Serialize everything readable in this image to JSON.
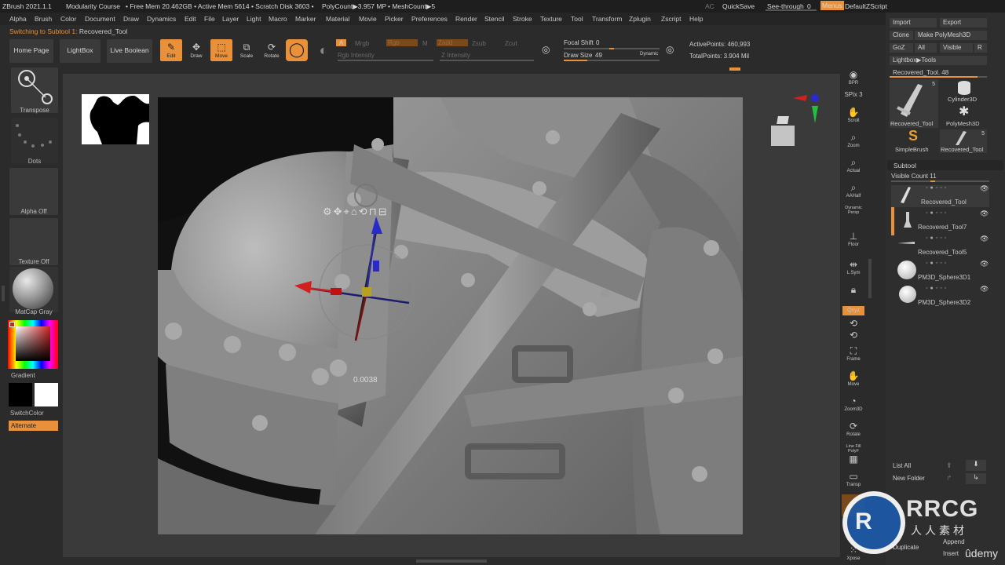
{
  "titlebar": {
    "app": "ZBrush 2021.1.1",
    "doc": "Modularity Course",
    "mem": "• Free Mem 20.462GB • Active Mem 5614 • Scratch Disk 3603 •",
    "poly": "PolyCount▶3.957 MP",
    "mesh": "• MeshCount▶5",
    "ac": "AC",
    "quicksave": "QuickSave",
    "seethrough": "See-through",
    "seethrough_val": "0",
    "menus": "Menus",
    "script": "DefaultZScript"
  },
  "menubar": [
    "Alpha",
    "Brush",
    "Color",
    "Document",
    "Draw",
    "Dynamics",
    "Edit",
    "File",
    "Layer",
    "Light",
    "Macro",
    "Marker",
    "Material",
    "Movie",
    "Picker",
    "Preferences",
    "Render",
    "Stencil",
    "Stroke",
    "Texture",
    "Tool",
    "Transform",
    "Zplugin",
    "Zscript",
    "Help"
  ],
  "notice": {
    "prefix": "Switching to Subtool 1:",
    "name": "Recovered_Tool"
  },
  "toolbar": {
    "home": "Home Page",
    "lightbox": "LightBox",
    "liveboolean": "Live Boolean",
    "edit": "Edit",
    "draw": "Draw",
    "move": "Move",
    "scale": "Scale",
    "rotate": "Rotate",
    "a": "A",
    "mrgb": "Mrgb",
    "rgb": "Rgb",
    "m": "M",
    "zadd": "Zadd",
    "zsub": "Zsub",
    "zcut": "Zcut",
    "rgb_intensity": "Rgb Intensity",
    "z_intensity": "Z Intensity",
    "focal_shift_label": "Focal Shift",
    "focal_shift_value": "0",
    "draw_size_label": "Draw Size",
    "draw_size_value": "49",
    "dynamic": "Dynamic",
    "active_points": "ActivePoints: 460,993",
    "total_points": "TotalPoints: 3.904 Mil"
  },
  "leftshelf": {
    "transpose": "Transpose",
    "dots": "Dots",
    "alpha": "Alpha Off",
    "texture": "Texture Off",
    "matcap": "MatCap Gray",
    "gradient": "Gradient",
    "switchcolor": "SwitchColor",
    "alternate": "Alternate"
  },
  "viewport": {
    "readout": "0.0038"
  },
  "rightshelf": [
    "BPR",
    "SPix 3",
    "Scroll",
    "Zoom",
    "Actual",
    "AAHalf",
    "Dynamic Persp",
    "Floor",
    "L.Sym",
    "Lock",
    "Qxyz",
    "Frame",
    "Move",
    "Zoom3D",
    "Rotate",
    "Line Fill PolyF",
    "Transp",
    "Xpose"
  ],
  "rightpanel": {
    "import": "Import",
    "export": "Export",
    "clone": "Clone",
    "make_polymesh": "Make PolyMesh3D",
    "goz": "GoZ",
    "all": "All",
    "visible": "Visible",
    "r": "R",
    "lightbox_tools": "Lightbox▶Tools",
    "tool_name": "Recovered_Tool. 48",
    "thumbs": [
      "Recovered_Tool",
      "Cylinder3D",
      "PolyMesh3D",
      "SimpleBrush",
      "Recovered_Tool"
    ],
    "thumb_counts": [
      "5",
      "5"
    ],
    "subtool_header": "Subtool",
    "visible_count": "Visible Count 11",
    "subtools": [
      "Recovered_Tool",
      "Recovered_Tool7",
      "Recovered_Tool5",
      "PM3D_Sphere3D1",
      "PM3D_Sphere3D2"
    ],
    "list_all": "List All",
    "new_folder": "New Folder",
    "duplicate": "Duplicate",
    "append": "Append",
    "insert": "Insert"
  },
  "watermark": {
    "brand": "RRCG",
    "sub": "人人素材",
    "udemy": "ûdemy"
  },
  "colors": {
    "accent": "#e8903a",
    "panel": "#2b2b2b",
    "viewport": "#111111"
  }
}
